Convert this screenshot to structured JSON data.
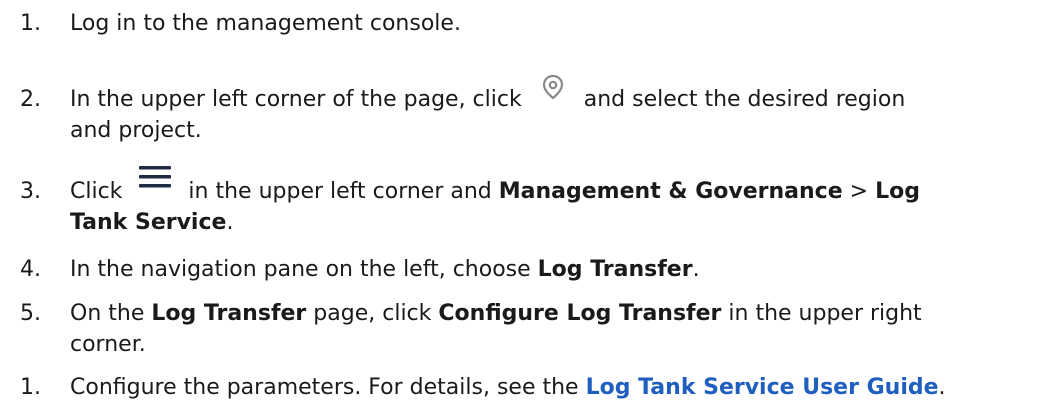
{
  "steps": [
    {
      "num": "1.",
      "text": "Log in to the management console."
    },
    {
      "num": "2.",
      "text_before": "In the upper left corner of the page, click",
      "icon": "location-pin-icon",
      "text_after_line1": "and select the desired region",
      "text_line2": "and project."
    },
    {
      "num": "3.",
      "text_before": "Click",
      "icon": "menu-icon",
      "text_mid": "in the upper left corner and",
      "bold1": "Management & Governance",
      "sep": ">",
      "bold2_line1": "Log",
      "bold2_line2": "Tank Service",
      "end": "."
    },
    {
      "num": "4.",
      "text_before": "In the navigation pane on the left, choose",
      "bold": "Log Transfer",
      "end": "."
    },
    {
      "num": "5.",
      "text_before": "On the",
      "bold1": "Log Transfer",
      "text_mid": "page, click",
      "bold2": "Configure Log Transfer",
      "text_after_line1": "in the upper right",
      "text_line2": "corner."
    },
    {
      "num": "1.",
      "text_before": "Configure the parameters. For details, see the",
      "link": "Log Tank Service User Guide",
      "end": "."
    }
  ],
  "colors": {
    "text": "#1a1a1a",
    "link": "#1f5fbf",
    "icon_gray": "#8a8a8a",
    "menu_navy": "#1f2a44"
  }
}
